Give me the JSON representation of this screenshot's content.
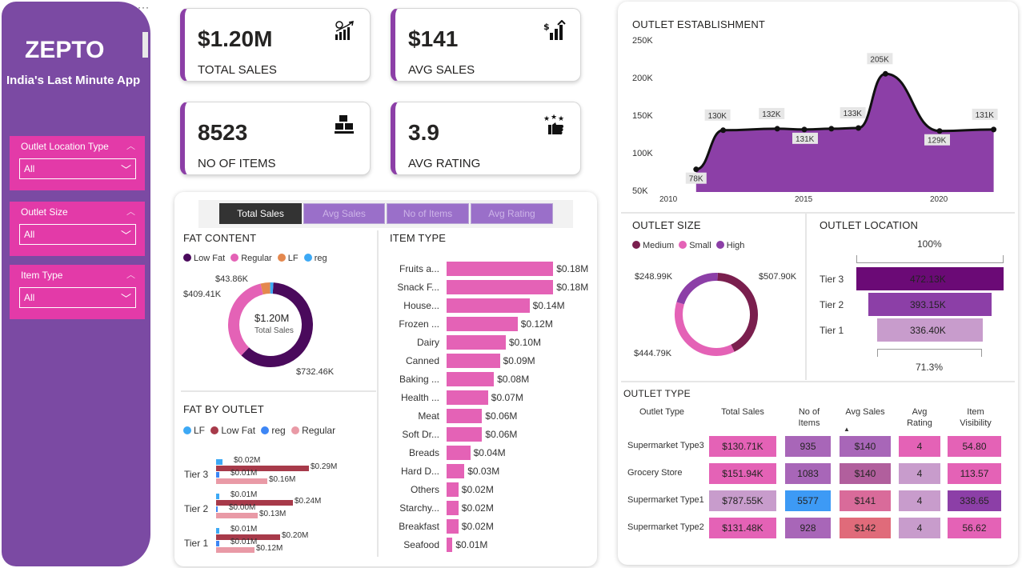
{
  "sidebar": {
    "brand": "ZEPTO",
    "tagline": "India's Last Minute App",
    "filters": [
      {
        "title": "Outlet Location Type",
        "value": "All"
      },
      {
        "title": "Outlet Size",
        "value": "All"
      },
      {
        "title": "Item Type",
        "value": "All"
      }
    ]
  },
  "kpis": [
    {
      "value": "$1.20M",
      "label": "TOTAL SALES",
      "icon": "sales-growth-icon"
    },
    {
      "value": "$141",
      "label": "AVG SALES",
      "icon": "avg-sales-icon"
    },
    {
      "value": "8523",
      "label": "NO OF ITEMS",
      "icon": "items-stack-icon"
    },
    {
      "value": "3.9",
      "label": "AVG RATING",
      "icon": "rating-stars-icon"
    }
  ],
  "tabs": [
    "Total Sales",
    "Avg Sales",
    "No of Items",
    "Avg Rating"
  ],
  "fat_content": {
    "title": "FAT CONTENT",
    "legend": [
      "Low Fat",
      "Regular",
      "LF",
      "reg"
    ],
    "center_value": "$1.20M",
    "center_label": "Total Sales",
    "labels": [
      "$43.86K",
      "$409.41K",
      "$732.46K"
    ]
  },
  "fat_by_outlet": {
    "title": "FAT BY OUTLET",
    "legend": [
      "LF",
      "Low Fat",
      "reg",
      "Regular"
    ],
    "tiers": [
      {
        "name": "Tier 3",
        "labels": [
          "$0.02M",
          "$0.29M",
          "$0.01M",
          "$0.16M"
        ]
      },
      {
        "name": "Tier 2",
        "labels": [
          "$0.01M",
          "$0.24M",
          "$0.00M",
          "$0.13M"
        ]
      },
      {
        "name": "Tier 1",
        "labels": [
          "$0.01M",
          "$0.20M",
          "$0.01M",
          "$0.12M"
        ]
      }
    ]
  },
  "item_type": {
    "title": "ITEM TYPE",
    "labels": [
      "$0.18M",
      "$0.18M",
      "$0.14M",
      "$0.12M",
      "$0.10M",
      "$0.09M",
      "$0.08M",
      "$0.07M",
      "$0.06M",
      "$0.06M",
      "$0.04M",
      "$0.03M",
      "$0.02M",
      "$0.02M",
      "$0.02M",
      "$0.01M"
    ]
  },
  "outlet_establishment": {
    "title": "OUTLET ESTABLISHMENT",
    "point_labels": [
      "78K",
      "130K",
      "132K",
      "131K",
      "133K",
      "205K",
      "129K",
      "131K"
    ]
  },
  "outlet_size": {
    "title": "OUTLET SIZE",
    "legend": [
      "Medium",
      "Small",
      "High"
    ],
    "labels": [
      "$507.90K",
      "$248.99K",
      "$444.79K"
    ]
  },
  "outlet_location": {
    "title": "OUTLET LOCATION",
    "top_pct": "100%",
    "bottom_pct": "71.3%"
  },
  "outlet_type": {
    "title": "OUTLET TYPE",
    "headers": [
      "Outlet Type",
      "Total Sales",
      "No of Items",
      "Avg Sales",
      "Avg Rating",
      "Item Visibility"
    ],
    "rows": [
      {
        "name": "Supermarket Type3",
        "sales": "$130.71K",
        "items": "935",
        "avg": "$140",
        "rating": "4",
        "vis": "54.80"
      },
      {
        "name": "Grocery Store",
        "sales": "$151.94K",
        "items": "1083",
        "avg": "$140",
        "rating": "4",
        "vis": "113.57"
      },
      {
        "name": "Supermarket Type1",
        "sales": "$787.55K",
        "items": "5577",
        "avg": "$141",
        "rating": "4",
        "vis": "338.65"
      },
      {
        "name": "Supermarket Type2",
        "sales": "$131.48K",
        "items": "928",
        "avg": "$142",
        "rating": "4",
        "vis": "56.62"
      }
    ]
  },
  "colors": {
    "sidebar": "#7b4aa3",
    "slicer": "#e33aa8",
    "low_fat": "#4a0a5c",
    "regular": "#e462b6",
    "lf": "#e4884e",
    "reg": "#3da9f5",
    "accent": "#8c3fa7"
  },
  "chart_data": [
    {
      "type": "donut",
      "title": "FAT CONTENT",
      "categories": [
        "Low Fat",
        "Regular",
        "LF",
        "reg"
      ],
      "values": [
        732.46,
        409.41,
        43.86,
        15
      ],
      "unit": "$K"
    },
    {
      "type": "bar",
      "title": "FAT BY OUTLET",
      "categories": [
        "Tier 3",
        "Tier 2",
        "Tier 1"
      ],
      "series": [
        {
          "name": "LF",
          "values": [
            0.02,
            0.01,
            0.01
          ]
        },
        {
          "name": "Low Fat",
          "values": [
            0.29,
            0.24,
            0.2
          ]
        },
        {
          "name": "reg",
          "values": [
            0.01,
            0.0,
            0.01
          ]
        },
        {
          "name": "Regular",
          "values": [
            0.16,
            0.13,
            0.12
          ]
        }
      ],
      "unit": "$M"
    },
    {
      "type": "bar",
      "title": "ITEM TYPE",
      "categories": [
        "Fruits a...",
        "Snack F...",
        "House...",
        "Frozen ...",
        "Dairy",
        "Canned",
        "Baking ...",
        "Health ...",
        "Meat",
        "Soft Dr...",
        "Breads",
        "Hard D...",
        "Others",
        "Starchy...",
        "Breakfast",
        "Seafood"
      ],
      "values": [
        0.18,
        0.18,
        0.14,
        0.12,
        0.1,
        0.09,
        0.08,
        0.07,
        0.06,
        0.06,
        0.04,
        0.03,
        0.02,
        0.02,
        0.02,
        0.01
      ],
      "unit": "$M"
    },
    {
      "type": "area",
      "title": "OUTLET ESTABLISHMENT",
      "x": [
        2011,
        2012,
        2014,
        2015,
        2016,
        2017,
        2018,
        2020,
        2022
      ],
      "y": [
        78,
        130,
        132,
        131,
        132,
        133,
        205,
        129,
        131
      ],
      "ylim": [
        50,
        250
      ],
      "yticks": [
        "250K",
        "200K",
        "150K",
        "100K",
        "50K"
      ],
      "xticks": [
        "2010",
        "2015",
        "2020"
      ],
      "xlim": [
        2010,
        2022
      ]
    },
    {
      "type": "donut",
      "title": "OUTLET SIZE",
      "categories": [
        "Medium",
        "Small",
        "High"
      ],
      "values": [
        507.9,
        444.79,
        248.99
      ],
      "unit": "$K"
    },
    {
      "type": "bar",
      "title": "OUTLET LOCATION",
      "categories": [
        "Tier 3",
        "Tier 2",
        "Tier 1"
      ],
      "values": [
        472.13,
        393.15,
        336.4
      ],
      "labels": [
        "472.13K",
        "393.15K",
        "336.40K"
      ],
      "unit": "$K"
    }
  ]
}
